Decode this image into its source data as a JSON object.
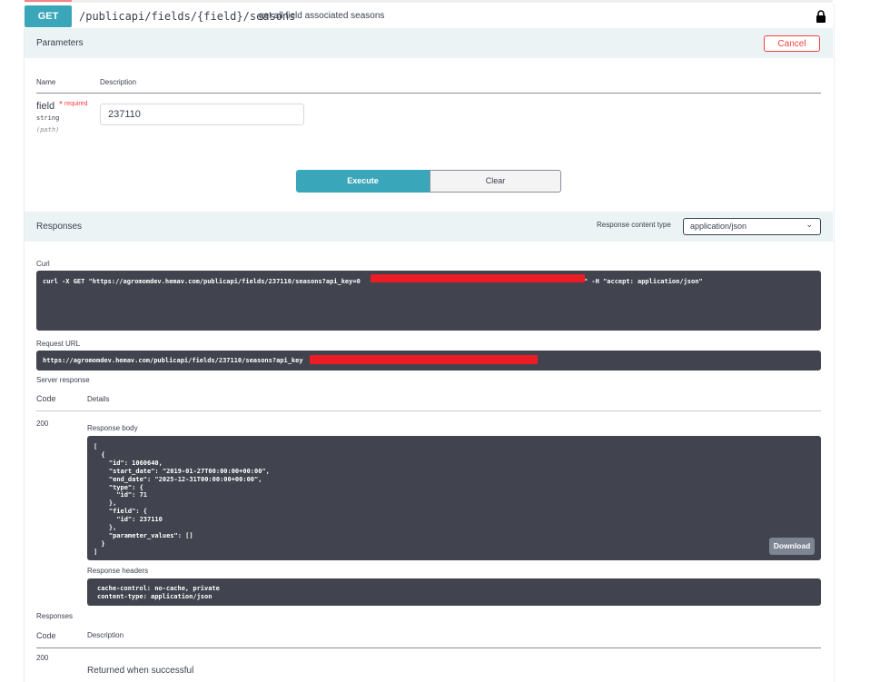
{
  "operation": {
    "method": "GET",
    "path": "/publicapi/fields/{field}/seasons",
    "summary": "get all field associated seasons"
  },
  "parameters": {
    "title": "Parameters",
    "cancel_label": "Cancel",
    "col_name": "Name",
    "col_description": "Description",
    "field": {
      "name": "field",
      "required_mark": "*",
      "required_label": "required",
      "type": "string",
      "in": "(path)",
      "value": "237110"
    }
  },
  "actions": {
    "execute_label": "Execute",
    "clear_label": "Clear"
  },
  "responses_header": {
    "title": "Responses",
    "content_type_label": "Response content type",
    "content_type_value": "application/json"
  },
  "curl": {
    "label": "Curl",
    "command_prefix": "curl -X GET \"https://agromomdev.hemav.com/publicapi/fields/237110/seasons?api_key=0",
    "command_suffix": "\" -H \"accept: application/json\""
  },
  "request_url": {
    "label": "Request URL",
    "url_prefix": "https://agromomdev.hemav.com/publicapi/fields/237110/seasons?api_key"
  },
  "server_response": {
    "label": "Server response",
    "col_code": "Code",
    "col_details": "Details",
    "code": "200",
    "body_label": "Response body",
    "body_lines": [
      "[",
      "  {",
      "    \"id\": 1060640,",
      "    \"start_date\": \"2019-01-27T00:00:00+00:00\",",
      "    \"end_date\": \"2025-12-31T00:00:00+00:00\",",
      "    \"type\": {",
      "      \"id\": 71",
      "    },",
      "    \"field\": {",
      "      \"id\": 237110",
      "    },",
      "    \"parameter_values\": []",
      "  }",
      "]"
    ],
    "download_label": "Download",
    "headers_label": "Response headers",
    "header_lines": [
      "cache-control: no-cache, private",
      "content-type: application/json"
    ]
  },
  "responses": {
    "label": "Responses",
    "col_code": "Code",
    "col_description": "Description",
    "code": "200",
    "description": "Returned when successful"
  },
  "colors": {
    "get_accent": "#3aa6b9",
    "cancel_red": "#f93e3e",
    "code_bg": "#41444e",
    "section_bg": "#ebf3f5",
    "redaction": "#ea1c24"
  },
  "icons": {
    "lock": "lock-icon",
    "select_chevron": "chevron-down-icon"
  }
}
